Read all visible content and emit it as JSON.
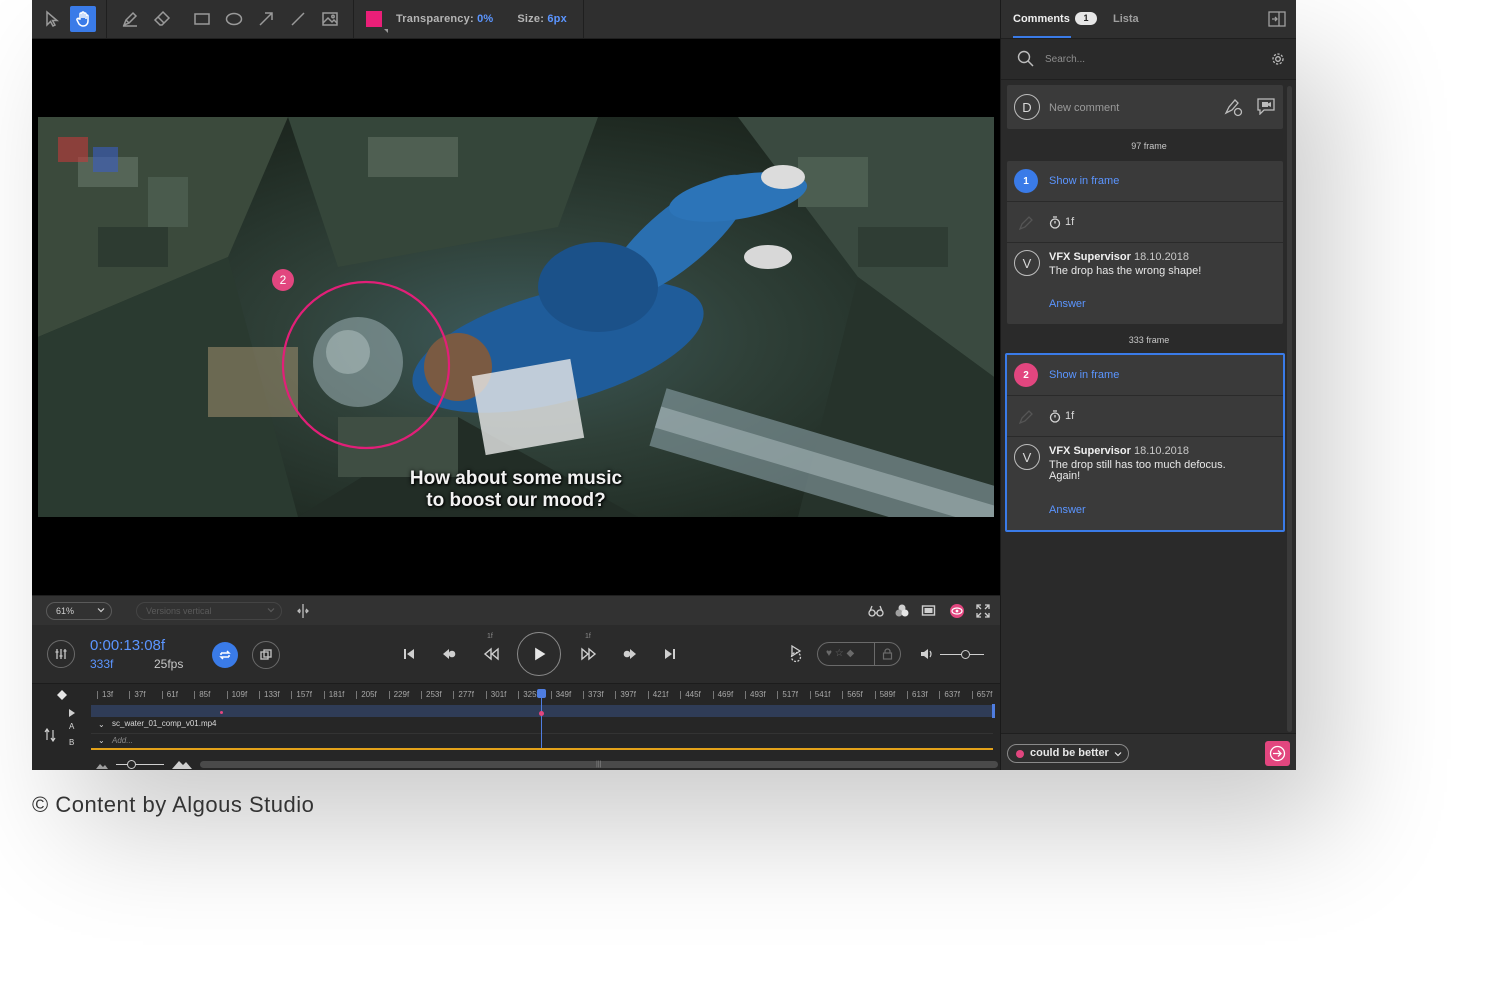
{
  "toolbar": {
    "tools": [
      "pointer-icon",
      "hand-icon",
      "pen-icon",
      "eraser-icon",
      "rectangle-icon",
      "ellipse-icon",
      "arrow-icon",
      "line-icon",
      "image-icon"
    ],
    "active_tool": "hand-icon",
    "color": "#ea1f78",
    "transparency_label": "Transparency:",
    "transparency_value": "0%",
    "size_label": "Size:",
    "size_value": "6",
    "size_unit": "px"
  },
  "viewer": {
    "subtitle_line1": "How about some music",
    "subtitle_line2": "to boost our mood?",
    "marker_label": "2",
    "marker_color": "#e2467f"
  },
  "options": {
    "zoom": "61%",
    "view_mode": "Versions vertical"
  },
  "transport": {
    "timecode": "0:00:13:08f",
    "frame": "333f",
    "fps": "25fps",
    "step_back_label": "1f",
    "step_forward_label": "1f"
  },
  "timeline": {
    "ticks": [
      "13f",
      "37f",
      "61f",
      "85f",
      "109f",
      "133f",
      "157f",
      "181f",
      "205f",
      "229f",
      "253f",
      "277f",
      "301f",
      "325f",
      "349f",
      "373f",
      "397f",
      "421f",
      "445f",
      "469f",
      "493f",
      "517f",
      "541f",
      "565f",
      "589f",
      "613f",
      "637f",
      "657f"
    ],
    "tracks": [
      {
        "id": "A",
        "name": "sc_water_01_comp_v01.mp4"
      },
      {
        "id": "B",
        "name": "Add..."
      }
    ],
    "playhead_frame": 333
  },
  "panel": {
    "tab_comments": "Comments",
    "comments_count": "1",
    "tab_list": "Lista",
    "search_placeholder": "Search...",
    "new_comment_avatar": "D",
    "new_comment_placeholder": "New comment",
    "groups": [
      {
        "frame_label": "97 frame",
        "number": "1",
        "number_color": "#3a7be8",
        "show_in_frame": "Show in frame",
        "duration": "1f",
        "avatar": "V",
        "author": "VFX Supervisor",
        "date": "18.10.2018",
        "text_line1": "The drop has the wrong shape!",
        "text_line2": "",
        "answer": "Answer",
        "selected": false
      },
      {
        "frame_label": "333 frame",
        "number": "2",
        "number_color": "#e2467f",
        "show_in_frame": "Show in frame",
        "duration": "1f",
        "avatar": "V",
        "author": "VFX Supervisor",
        "date": "18.10.2018",
        "text_line1": "The drop still has too much defocus.",
        "text_line2": "Again!",
        "answer": "Answer",
        "selected": true
      }
    ],
    "status": "could be better",
    "status_color": "#e2467f"
  },
  "credit": "© Content by Algous Studio",
  "colors": {
    "accent": "#3a7be8",
    "link": "#5b95ff",
    "pink": "#e2467f"
  }
}
